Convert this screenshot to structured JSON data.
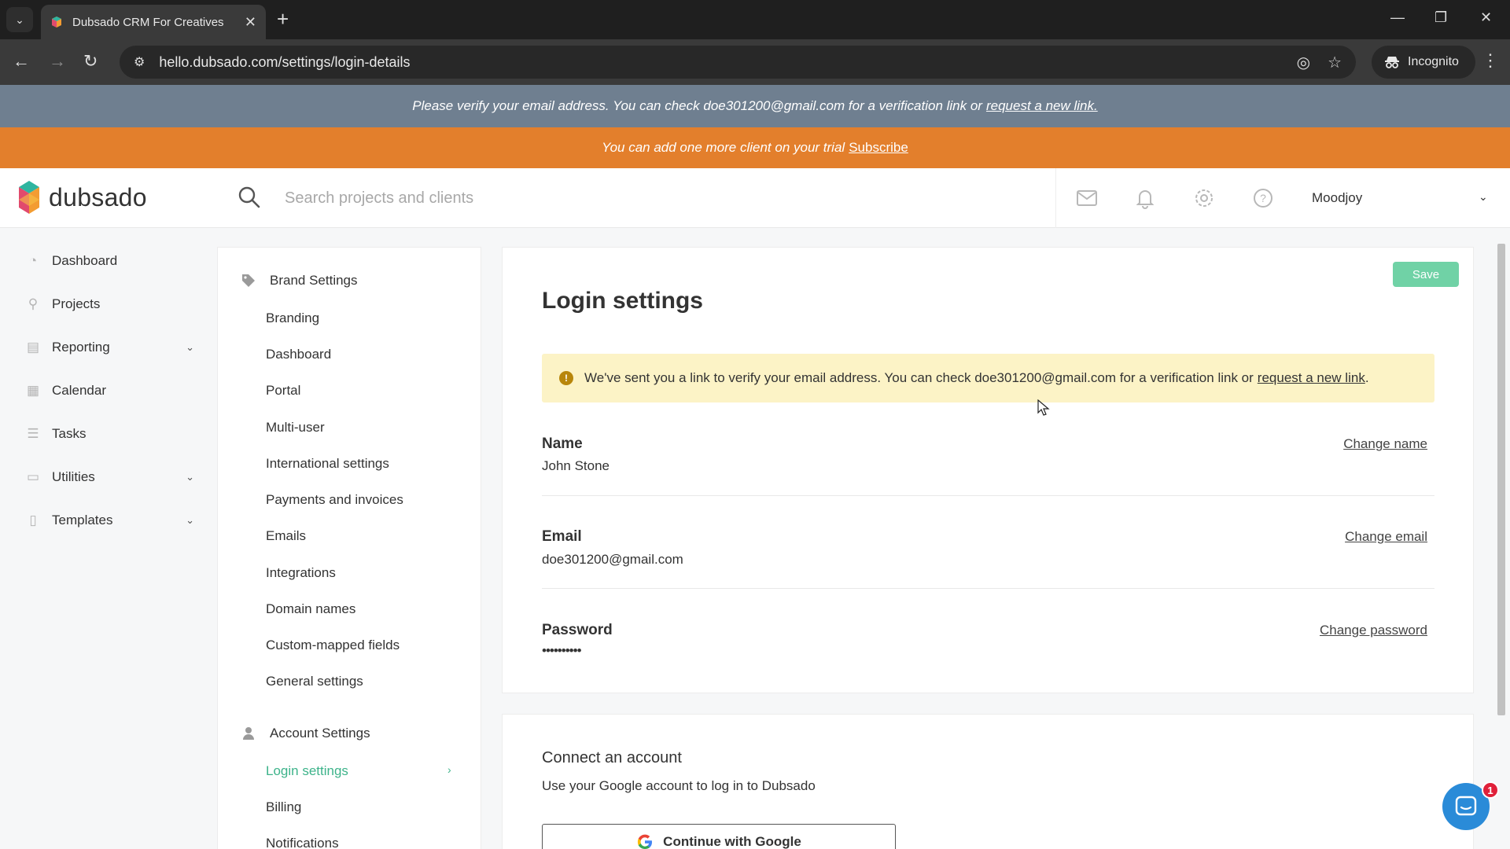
{
  "browser": {
    "tab_title": "Dubsado CRM For Creatives",
    "url": "hello.dubsado.com/settings/login-details",
    "incognito_label": "Incognito"
  },
  "banners": {
    "verify_text": "Please verify your email address. You can check doe301200@gmail.com for a verification link or",
    "verify_link": "request a new link.",
    "trial_text": "You can add one more client on your trial",
    "trial_link": "Subscribe"
  },
  "header": {
    "logo_text": "dubsado",
    "search_placeholder": "Search projects and clients",
    "user_name": "Moodjoy"
  },
  "sidebar": {
    "items": [
      {
        "label": "Dashboard",
        "icon": "dashboard-icon",
        "has_chevron": false
      },
      {
        "label": "Projects",
        "icon": "projects-icon",
        "has_chevron": false
      },
      {
        "label": "Reporting",
        "icon": "reporting-icon",
        "has_chevron": true
      },
      {
        "label": "Calendar",
        "icon": "calendar-icon",
        "has_chevron": false
      },
      {
        "label": "Tasks",
        "icon": "tasks-icon",
        "has_chevron": false
      },
      {
        "label": "Utilities",
        "icon": "utilities-icon",
        "has_chevron": true
      },
      {
        "label": "Templates",
        "icon": "templates-icon",
        "has_chevron": true
      }
    ]
  },
  "settings_nav": {
    "brand_group": "Brand Settings",
    "brand_items": [
      "Branding",
      "Dashboard",
      "Portal",
      "Multi-user",
      "International settings",
      "Payments and invoices",
      "Emails",
      "Integrations",
      "Domain names",
      "Custom-mapped fields",
      "General settings"
    ],
    "account_group": "Account Settings",
    "account_items": [
      "Login settings",
      "Billing",
      "Notifications"
    ],
    "active_item": "Login settings"
  },
  "main": {
    "save_label": "Save",
    "title": "Login settings",
    "alert_text": "We've sent you a link to verify your email address. You can check doe301200@gmail.com for a verification link or",
    "alert_link": "request a new link",
    "alert_end": ".",
    "name_label": "Name",
    "name_value": "John Stone",
    "name_action": "Change name",
    "email_label": "Email",
    "email_value": "doe301200@gmail.com",
    "email_action": "Change email",
    "password_label": "Password",
    "password_value": "••••••••••",
    "password_action": "Change password",
    "connect_title": "Connect an account",
    "connect_sub": "Use your Google account to log in to Dubsado",
    "google_button": "Continue with Google"
  },
  "chat": {
    "badge_count": "1"
  },
  "colors": {
    "accent_green": "#3db38a",
    "save_green": "#70d2a6",
    "trial_orange": "#e37f2c",
    "verify_slate": "#6f7f90",
    "alert_yellow": "#fcf3c6"
  }
}
